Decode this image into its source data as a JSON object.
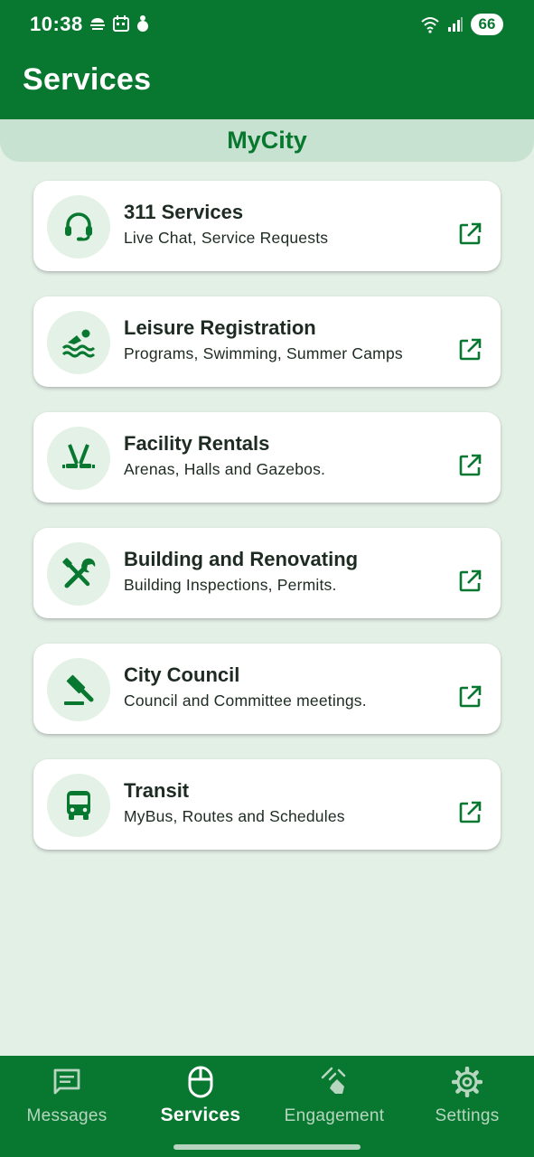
{
  "status_bar": {
    "time": "10:38",
    "battery": "66",
    "left_icons": [
      "weather-icon",
      "calendar-icon",
      "figure-icon"
    ],
    "right_icons": [
      "wifi-icon",
      "signal-icon"
    ]
  },
  "header": {
    "title": "Services"
  },
  "subheader": {
    "title": "MyCity"
  },
  "services": [
    {
      "title": "311 Services",
      "subtitle": "Live Chat, Service Requests",
      "icon": "headset-icon"
    },
    {
      "title": "Leisure Registration",
      "subtitle": "Programs, Swimming, Summer Camps",
      "icon": "swimming-icon"
    },
    {
      "title": "Facility Rentals",
      "subtitle": "Arenas, Halls and Gazebos.",
      "icon": "hockey-icon"
    },
    {
      "title": "Building and Renovating",
      "subtitle": "Building Inspections, Permits.",
      "icon": "tools-icon"
    },
    {
      "title": "City Council",
      "subtitle": "Council and Committee meetings.",
      "icon": "gavel-icon"
    },
    {
      "title": "Transit",
      "subtitle": "MyBus, Routes and Schedules",
      "icon": "bus-icon"
    }
  ],
  "bottom_nav": [
    {
      "label": "Messages",
      "icon": "message-icon",
      "active": false
    },
    {
      "label": "Services",
      "icon": "mouse-icon",
      "active": true
    },
    {
      "label": "Engagement",
      "icon": "engagement-icon",
      "active": false
    },
    {
      "label": "Settings",
      "icon": "gear-icon",
      "active": false
    }
  ],
  "colors": {
    "primary": "#08772f",
    "background": "#e3f0e6",
    "subheader": "#c7e2d0",
    "icon_circle": "#e3f1e6"
  }
}
